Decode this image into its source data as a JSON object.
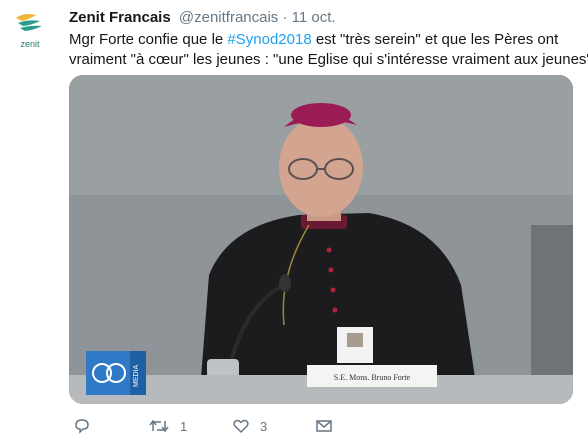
{
  "tweet": {
    "author_name": "Zenit Francais",
    "author_handle": "@zenitfrancais",
    "separator": "·",
    "date": "11 oct.",
    "avatar_label": "zenit",
    "text_part1": "Mgr Forte confie que le ",
    "hashtag": "#Synod2018",
    "text_part2": " est \"très serein\" et que les Pères ont",
    "text_line2": "vraiment \"à cœur\" les jeunes : \"une Eglise qui s'intéresse vraiment aux jeunes\"",
    "media": {
      "logo_label": "MEDIA",
      "nameplate": "S.E. Mons. Bruno Forte"
    },
    "actions": {
      "reply_count": "",
      "retweet_count": "1",
      "like_count": "3"
    }
  },
  "colors": {
    "hashtag": "#1da1f2",
    "secondary_text": "#657786",
    "brand_teal": "#2a9d8f",
    "vatican_media_blue": "#2f79c6"
  },
  "icons": [
    "zenit-logo-icon",
    "reply-icon",
    "retweet-icon",
    "like-icon",
    "dm-icon",
    "vatican-media-logo-icon"
  ]
}
